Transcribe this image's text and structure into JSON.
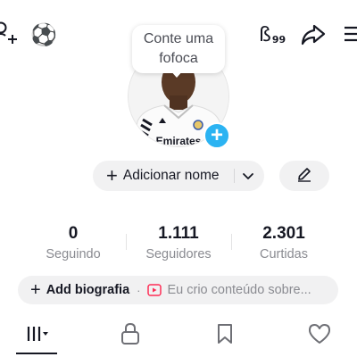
{
  "top_bar": {
    "icons": [
      "add-friend-icon",
      "soccer-ball-icon",
      "ai-badge-icon",
      "share-icon",
      "menu-icon"
    ],
    "ball_glyph": "⚽",
    "ai_badge_main": "ß",
    "ai_badge_sub": "99"
  },
  "note": {
    "text": "Conte uma fofoca"
  },
  "avatar": {
    "add_symbol": "+"
  },
  "name_pill": {
    "plus": "+",
    "label": "Adicionar nome"
  },
  "stats": [
    {
      "value": "0",
      "label": "Seguindo"
    },
    {
      "value": "1.111",
      "label": "Seguidores"
    },
    {
      "value": "2.301",
      "label": "Curtidas"
    }
  ],
  "bio": {
    "plus": "+",
    "label": "Add biografia",
    "separator": "·",
    "suggestion": "Eu crio conteúdo sobre..."
  },
  "tabs": [
    {
      "icon": "videos-grid-icon",
      "selected": true
    },
    {
      "icon": "lock-icon",
      "selected": false
    },
    {
      "icon": "bookmark-icon",
      "selected": false
    },
    {
      "icon": "heart-icon",
      "selected": false
    }
  ],
  "colors": {
    "accent_blue": "#2bb3f2",
    "pill_bg": "#f1f1f2",
    "text": "#161823",
    "muted": "#8a8b91",
    "video_icon": "#fe2c55"
  }
}
